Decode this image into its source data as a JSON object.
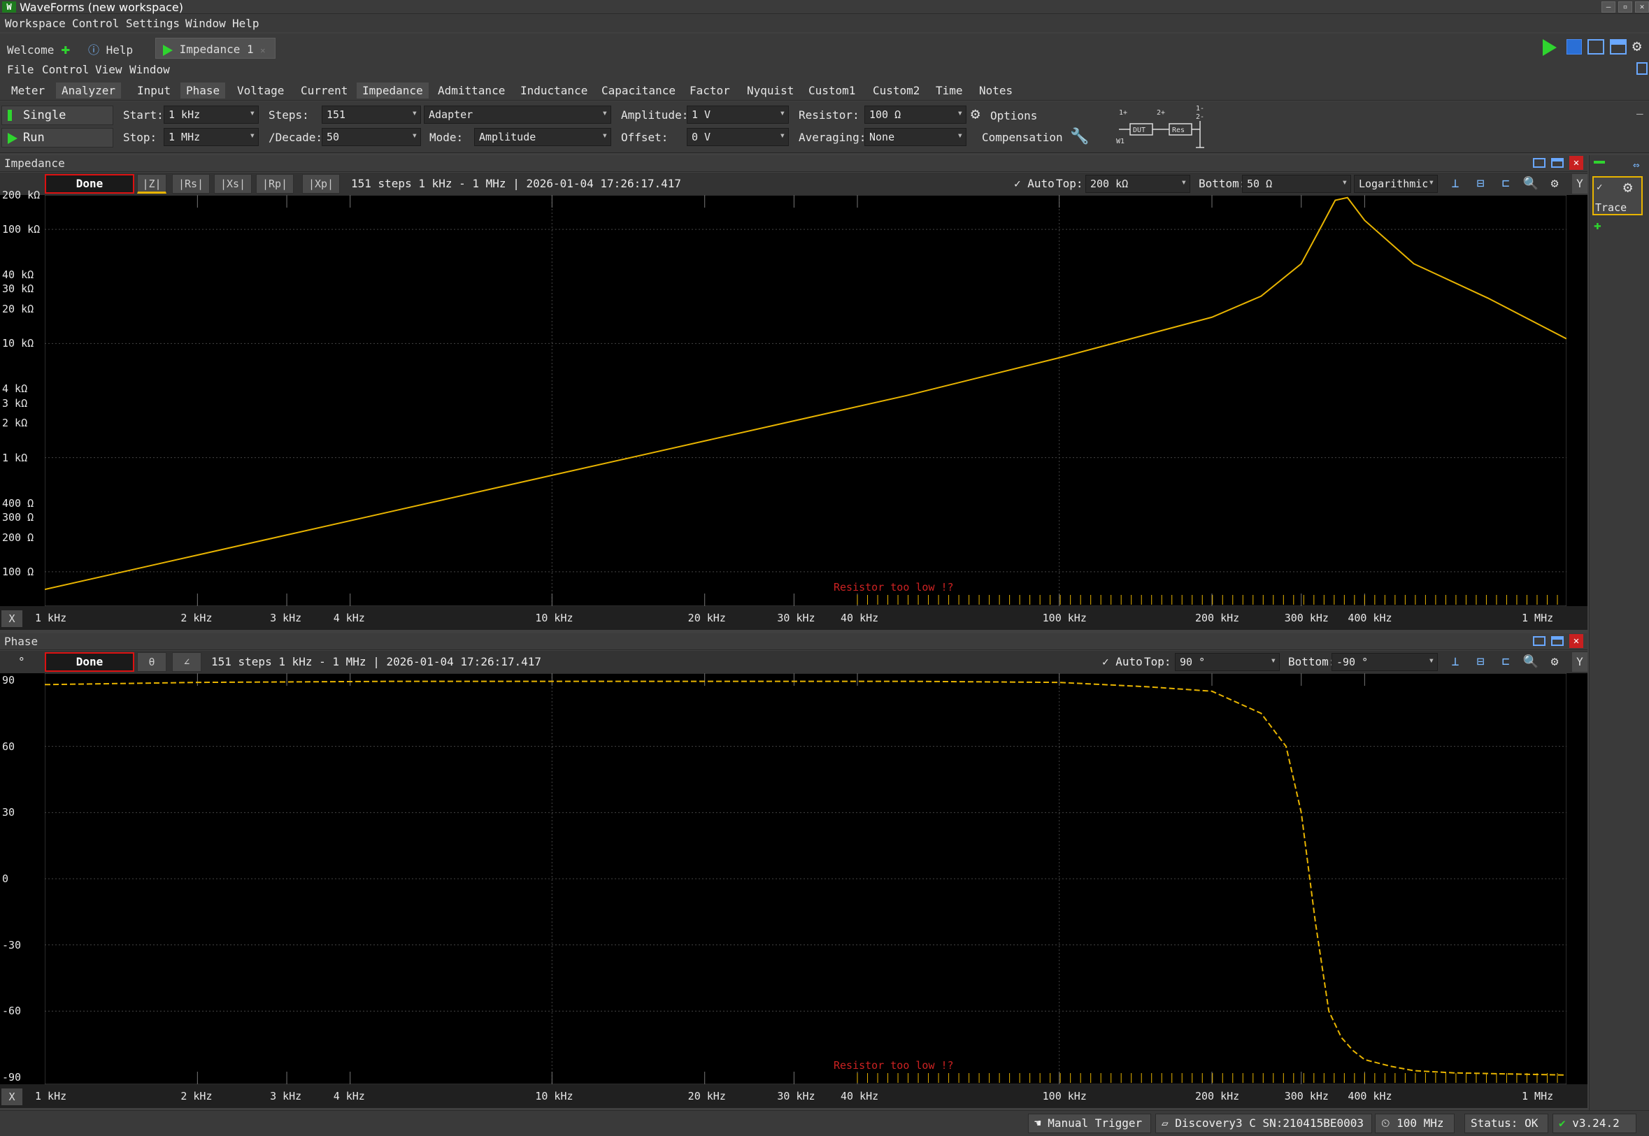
{
  "app": {
    "title": "WaveForms (new workspace)"
  },
  "menu": [
    "Workspace",
    "Control",
    "Settings",
    "Window",
    "Help"
  ],
  "doc_tabs": {
    "welcome": "Welcome",
    "help": "Help",
    "impedance": "Impedance 1"
  },
  "submenu": [
    "File",
    "Control",
    "View",
    "Window"
  ],
  "view_tabs": [
    "Meter",
    "Analyzer",
    "Input",
    "Phase",
    "Voltage",
    "Current",
    "Impedance",
    "Admittance",
    "Inductance",
    "Capacitance",
    "Factor",
    "Nyquist",
    "Custom1",
    "Custom2",
    "Time",
    "Notes"
  ],
  "controls": {
    "single": "Single",
    "run": "Run",
    "start_label": "Start:",
    "start": "1 kHz",
    "stop_label": "Stop:",
    "stop": "1 MHz",
    "steps_label": "Steps:",
    "steps": "151",
    "decade_label": "/Decade:",
    "decade": "50",
    "adapter": "Adapter",
    "mode_label": "Mode:",
    "mode": "Amplitude",
    "amplitude_label": "Amplitude:",
    "amplitude": "1 V",
    "offset_label": "Offset:",
    "offset": "0 V",
    "resistor_label": "Resistor:",
    "resistor": "100 Ω",
    "averaging_label": "Averaging:",
    "averaging": "None",
    "options": "Options",
    "compensation": "Compensation",
    "circuit": {
      "p1": "1+",
      "p2": "2+",
      "p3": "1-",
      "p4": "2-",
      "w1": "W1",
      "dut": "DUT",
      "res": "Res"
    }
  },
  "impedance_panel": {
    "title": "Impedance",
    "status": "Done",
    "buttons": [
      "|Z|",
      "|Rs|",
      "|Xs|",
      "|Rp|",
      "|Xp|"
    ],
    "info": "151 steps 1 kHz - 1 MHz | 2026-01-04 17:26:17.417",
    "auto": "✓ Auto",
    "top_label": "Top:",
    "top": "200 kΩ",
    "bottom_label": "Bottom:",
    "bottom": "50 Ω",
    "scale": "Logarithmic",
    "y_ticks": [
      "200 kΩ",
      "100 kΩ",
      "40 kΩ",
      "30 kΩ",
      "20 kΩ",
      "10 kΩ",
      "4 kΩ",
      "3 kΩ",
      "2 kΩ",
      "1 kΩ",
      "400 Ω",
      "300 Ω",
      "200 Ω",
      "100 Ω"
    ],
    "warning": "Resistor too low !?",
    "x_button": "X",
    "y_button": "Y"
  },
  "phase_panel": {
    "title": "Phase",
    "unit": "°",
    "status": "Done",
    "buttons": [
      "θ",
      "∠"
    ],
    "info": "151 steps 1 kHz - 1 MHz | 2026-01-04 17:26:17.417",
    "auto": "✓ Auto",
    "top_label": "Top:",
    "top": "90 °",
    "bottom_label": "Bottom:",
    "bottom": "-90 °",
    "y_ticks": [
      "90",
      "60",
      "30",
      "0",
      "-30",
      "-60",
      "-90"
    ],
    "warning": "Resistor too low !?",
    "x_button": "X",
    "y_button": "Y"
  },
  "x_ticks": [
    "1 kHz",
    "2 kHz",
    "3 kHz",
    "4 kHz",
    "10 kHz",
    "20 kHz",
    "30 kHz",
    "40 kHz",
    "100 kHz",
    "200 kHz",
    "300 kHz",
    "400 kHz",
    "1 MHz"
  ],
  "trace_panel": {
    "label": "Trace",
    "check": "✓"
  },
  "statusbar": {
    "trigger": "Manual Trigger",
    "device": "Discovery3 C SN:210415BE0003",
    "clock": "100 MHz",
    "status": "Status: OK",
    "version": "v3.24.2"
  },
  "colors": {
    "trace": "#e8b400",
    "warning": "#cc2222",
    "accent": "#2fd42f",
    "done_border": "#dd1111"
  },
  "chart_data": [
    {
      "type": "line",
      "title": "Impedance",
      "xlabel": "",
      "ylabel": "",
      "x_scale": "log",
      "y_scale": "log",
      "xlim": [
        1000,
        1000000
      ],
      "ylim": [
        50,
        200000
      ],
      "series": [
        {
          "name": "|Z|",
          "x": [
            1000,
            2000,
            3000,
            5000,
            10000,
            20000,
            50000,
            100000,
            200000,
            250000,
            300000,
            330000,
            350000,
            370000,
            400000,
            500000,
            700000,
            1000000
          ],
          "y": [
            70,
            140,
            210,
            350,
            700,
            1400,
            3500,
            7500,
            17000,
            26000,
            50000,
            110000,
            180000,
            190000,
            120000,
            50000,
            25000,
            11000
          ]
        }
      ]
    },
    {
      "type": "line",
      "title": "Phase",
      "xlabel": "",
      "ylabel": "°",
      "x_scale": "log",
      "xlim": [
        1000,
        1000000
      ],
      "ylim": [
        -90,
        90
      ],
      "series": [
        {
          "name": "θ",
          "x": [
            1000,
            2000,
            5000,
            10000,
            50000,
            100000,
            150000,
            200000,
            250000,
            280000,
            300000,
            320000,
            340000,
            360000,
            380000,
            400000,
            450000,
            500000,
            600000,
            1000000
          ],
          "y": [
            88,
            89,
            89.5,
            89.5,
            89.5,
            89,
            87,
            85,
            75,
            60,
            30,
            -20,
            -60,
            -72,
            -78,
            -82,
            -85,
            -87,
            -88,
            -89
          ]
        }
      ]
    }
  ]
}
